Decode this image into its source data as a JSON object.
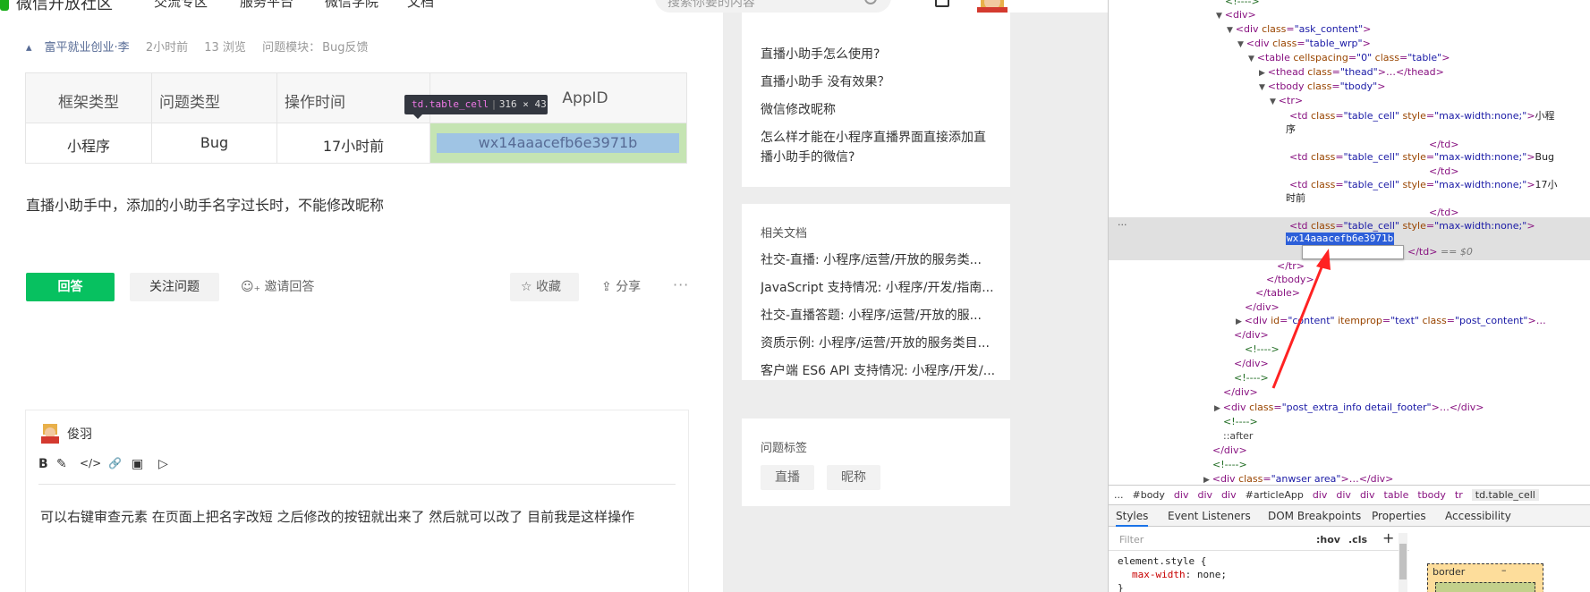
{
  "site": {
    "brand": "微信开放社区",
    "nav": [
      "交流专区",
      "服务平台",
      "微信学院",
      "文档"
    ],
    "search_placeholder": "搜索你要的内容"
  },
  "question": {
    "meta": {
      "author": "富平就业创业·李",
      "time": "2小时前",
      "views": "13 浏览",
      "module": "问题模块：",
      "module_value": "Bug反馈"
    },
    "table": {
      "headers": [
        "框架类型",
        "问题类型",
        "操作时间",
        "AppID"
      ],
      "row": [
        "小程序",
        "Bug",
        "17小时前",
        "wx14aaacefb6e3971b"
      ]
    },
    "tooltip": {
      "tag": "td.table_cell",
      "dims": "316 × 43"
    },
    "body": "直播小助手中，添加的小助手名字过长时，不能修改昵称",
    "actions": {
      "answer": "回答",
      "follow": "关注问题",
      "invite": "邀请回答",
      "collect": "收藏",
      "share": "分享",
      "more": "···"
    }
  },
  "answer": {
    "user": "俊羽",
    "toolbar": [
      "B",
      "✎",
      "</>",
      "🔗",
      "▣",
      "▷"
    ],
    "text": "可以右键审查元素  在页面上把名字改短  之后修改的按钮就出来了  然后就可以改了 目前我是这样操作"
  },
  "sidebar": {
    "related_questions": [
      "直播小助手怎么使用?",
      "直播小助手 没有效果？",
      "微信修改昵称",
      "怎么样才能在小程序直播界面直接添加直播小助手的微信?"
    ],
    "related_docs": {
      "title": "相关文档",
      "items": [
        "社交-直播: 小程序/运营/开放的服务类...",
        "JavaScript 支持情况: 小程序/开发/指南...",
        "社交-直播答题: 小程序/运营/开放的服...",
        "资质示例: 小程序/运营/开放的服务类目...",
        "客户端 ES6 API 支持情况: 小程序/开发/..."
      ]
    },
    "tags": {
      "title": "问题标签",
      "items": [
        "直播",
        "昵称"
      ]
    }
  },
  "devtools": {
    "selected_text": "wx14aaacefb6e3971b",
    "lines": {
      "l0": "<!---->",
      "l1": "<div>",
      "l2a": "<div ",
      "l2b": "class",
      "l2c": "\"ask_content\"",
      "l3c": "\"table_wrp\"",
      "l4a": "cellspacing",
      "l4b": "\"0\"",
      "l4c": "\"table\"",
      "l5c": "\"thead\"",
      "l5d": "…</thead>",
      "l6c": "\"tbody\"",
      "l7": "<tr>",
      "td_class": "\"table_cell\"",
      "td_style_attr": "style",
      "td_style": "\"max-width:none;\"",
      "c1a": "小程",
      "c1b": "序",
      "c2": "Bug",
      "c3a": "17小",
      "c3b": "时前",
      "td_close": "</td>",
      "eq0": "== $0",
      "tr_close": "</tr>",
      "tbody_close": "</tbody>",
      "table_close": "</table>",
      "div_close": "</div>",
      "content_a": "<div ",
      "content_id": "id",
      "content_idv": "\"content\"",
      "content_ip": "itemprop",
      "content_ipv": "\"text\"",
      "content_cv": "\"post_content\"",
      "content_end": ">…",
      "footer_cv": "\"post_extra_info detail_footer\"",
      "footer_end": ">…</div>",
      "after": "::after",
      "anwser_cv": "\"anwser  area\"",
      "anwser_end": ">…</div>",
      "dots": "···"
    },
    "breadcrumbs": [
      "...",
      "#body",
      "div",
      "div",
      "div",
      "#articleApp",
      "div",
      "div",
      "div",
      "table",
      "tbody",
      "tr",
      "td.table_cell"
    ],
    "tabs": [
      "Styles",
      "Event Listeners",
      "DOM Breakpoints",
      "Properties",
      "Accessibility"
    ],
    "filter": {
      "placeholder": "Filter",
      "hov": ":hov",
      "cls": ".cls",
      "plus": "+"
    },
    "styles": {
      "selector": "element.style {",
      "prop": "max-width",
      "val": "none;",
      "close": "}"
    },
    "boxmodel": {
      "label": "border",
      "dash": "–"
    }
  },
  "colors": {
    "brand_green": "#07c160",
    "link_blue": "#576b95",
    "selection_blue": "#2d5fd9",
    "annotation_red": "#ff2222"
  }
}
